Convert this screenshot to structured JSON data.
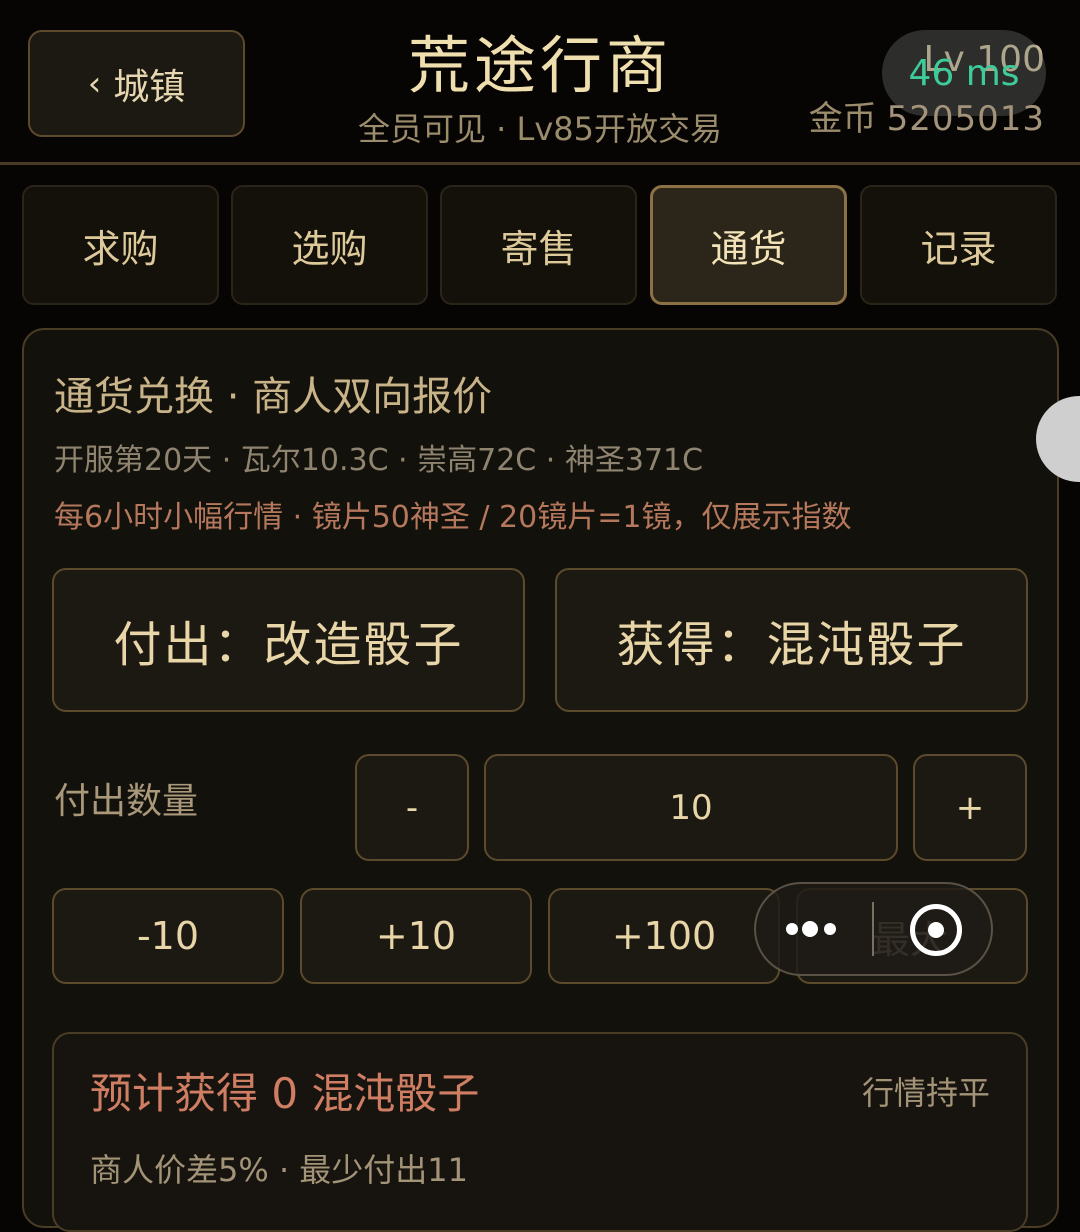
{
  "header": {
    "back_label": "城镇",
    "title": "荒途行商",
    "subtitle": "全员可见 · Lv85开放交易",
    "level": "Lv 100",
    "latency": "46 ms",
    "coins_label": "金币",
    "coins_value": "5205013"
  },
  "tabs": [
    {
      "label": "求购",
      "active": false
    },
    {
      "label": "选购",
      "active": false
    },
    {
      "label": "寄售",
      "active": false
    },
    {
      "label": "通货",
      "active": true
    },
    {
      "label": "记录",
      "active": false
    }
  ],
  "exchange": {
    "title": "通货兑换 · 商人双向报价",
    "info": "开服第20天 · 瓦尔10.3C · 崇高72C · 神圣371C",
    "note": "每6小时小幅行情 · 镜片50神圣 / 20镜片=1镜，仅展示指数",
    "pay_button": "付出：改造骰子",
    "get_button": "获得：混沌骰子",
    "qty_label": "付出数量",
    "minus_label": "-",
    "qty_value": "10",
    "plus_label": "+",
    "quick": [
      "-10",
      "+10",
      "+100",
      "最大"
    ]
  },
  "result": {
    "title": "预计获得 0 混沌骰子",
    "status": "行情持平",
    "sub": "商人价差5% · 最少付出11"
  },
  "icons": {
    "back": "chevron-left-icon",
    "more": "more-dots-icon",
    "close": "target-close-icon"
  },
  "colors": {
    "accent": "#8b7144",
    "warning_text": "#d07e63",
    "latency": "#3ecb9a"
  }
}
